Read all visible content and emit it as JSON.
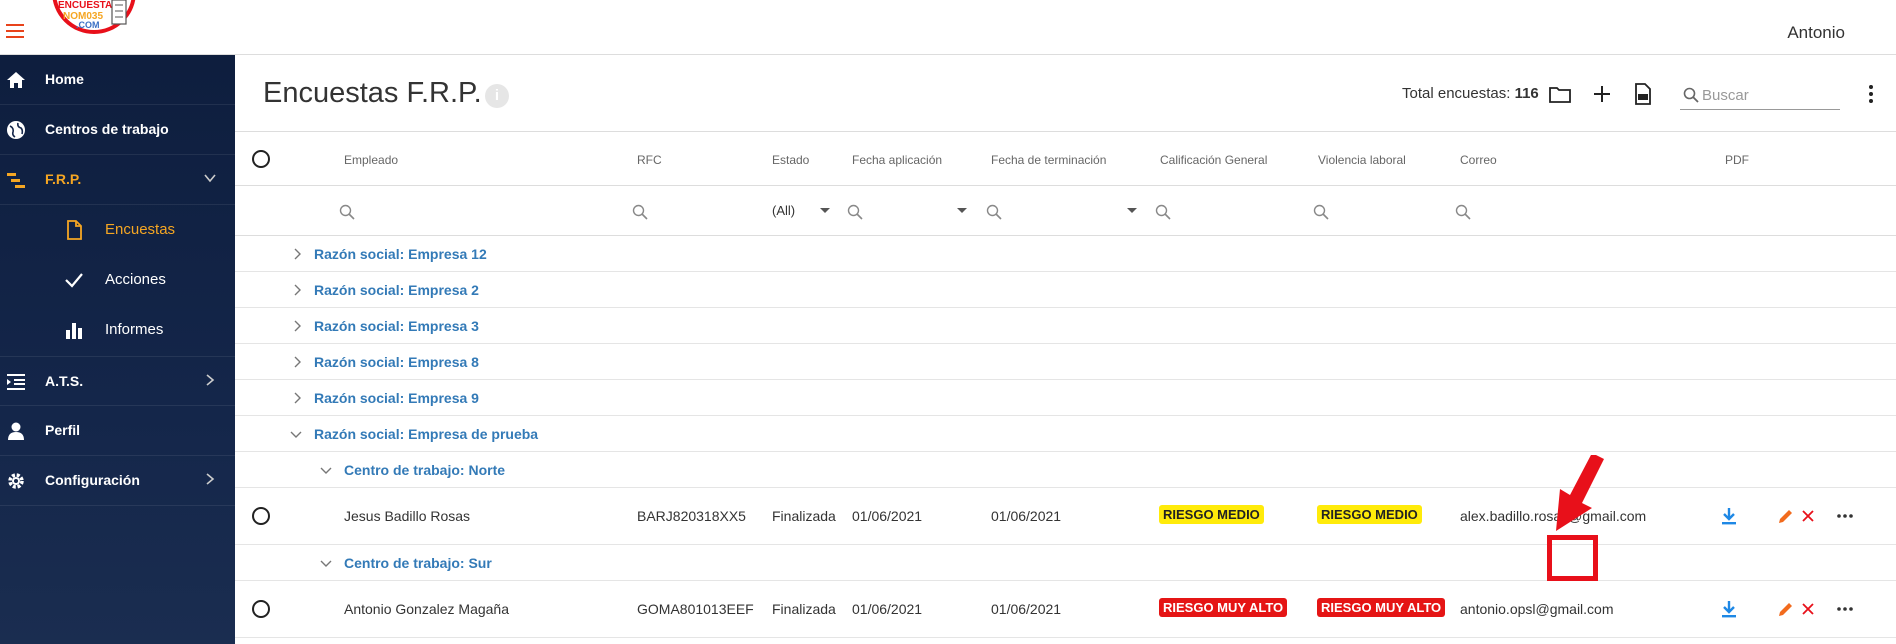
{
  "app": {
    "user_name": "Antonio",
    "logo_text_top": "ENCUESTA",
    "logo_text_mid": "NOM035",
    "logo_text_bot": ".COM"
  },
  "sidebar": {
    "items": [
      {
        "label": "Home",
        "icon": "home-icon"
      },
      {
        "label": "Centros de trabajo",
        "icon": "globe-icon"
      },
      {
        "label": "F.R.P.",
        "icon": "frp-icon",
        "expanded": true
      },
      {
        "label": "A.T.S.",
        "icon": "list-icon"
      },
      {
        "label": "Perfil",
        "icon": "person-icon"
      },
      {
        "label": "Configuración",
        "icon": "gear-icon"
      }
    ],
    "subitems": [
      {
        "label": "Encuestas",
        "icon": "document-icon",
        "active": true
      },
      {
        "label": "Acciones",
        "icon": "check-icon"
      },
      {
        "label": "Informes",
        "icon": "bar-chart-icon"
      }
    ]
  },
  "header": {
    "title": "Encuestas F.R.P.",
    "info_glyph": "i",
    "total_label": "Total encuestas:",
    "total_value": "116",
    "search_placeholder": "Buscar"
  },
  "columns": {
    "empleado": "Empleado",
    "rfc": "RFC",
    "estado": "Estado",
    "fecha_aplicacion": "Fecha aplicación",
    "fecha_terminacion": "Fecha de terminación",
    "calificacion": "Calificación General",
    "violencia": "Violencia laboral",
    "correo": "Correo",
    "pdf": "PDF"
  },
  "filters": {
    "estado_value": "(All)"
  },
  "groups": [
    {
      "label": "Razón social: Empresa 12",
      "expanded": false
    },
    {
      "label": "Razón social: Empresa 2",
      "expanded": false
    },
    {
      "label": "Razón social: Empresa 3",
      "expanded": false
    },
    {
      "label": "Razón social: Empresa 8",
      "expanded": false
    },
    {
      "label": "Razón social: Empresa 9",
      "expanded": false
    },
    {
      "label": "Razón social: Empresa de prueba",
      "expanded": true
    }
  ],
  "subgroups": [
    {
      "label": "Centro de trabajo: Norte"
    },
    {
      "label": "Centro de trabajo: Sur"
    }
  ],
  "rows": [
    {
      "empleado": "Jesus Badillo Rosas",
      "rfc": "BARJ820318XX5",
      "estado": "Finalizada",
      "fecha_aplicacion": "01/06/2021",
      "fecha_terminacion": "01/06/2021",
      "calificacion": "RIESGO MEDIO",
      "violencia": "RIESGO MEDIO",
      "correo": "alex.badillo.rosas@gmail.com"
    },
    {
      "empleado": "Antonio Gonzalez Magaña",
      "rfc": "GOMA801013EEF",
      "estado": "Finalizada",
      "fecha_aplicacion": "01/06/2021",
      "fecha_terminacion": "01/06/2021",
      "calificacion": "RIESGO MUY ALTO",
      "violencia": "RIESGO MUY ALTO",
      "correo": "antonio.opsl@gmail.com"
    }
  ],
  "colors": {
    "accent_orange": "#e8431b",
    "sidebar_bg": "#0e1e3e",
    "link_blue": "#337ab7",
    "badge_medio": "#ffeb0a",
    "badge_alto": "#e51515",
    "highlight_red": "#e8101a"
  }
}
